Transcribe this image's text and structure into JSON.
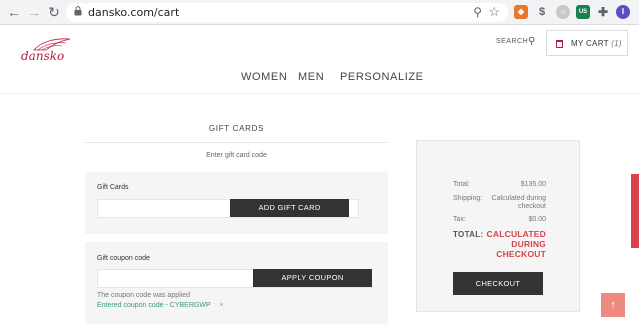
{
  "browser": {
    "url": "dansko.com/cart",
    "back_icon": "back-arrow-icon",
    "forward_icon": "forward-arrow-icon",
    "reload_icon": "reload-icon",
    "profile_initial": "I",
    "extensions": [
      "ext-badge",
      "ext-honey",
      "ext-dollar",
      "ext-circle",
      "ext-us",
      "puzzle-icon"
    ]
  },
  "header": {
    "logo_text": "dansko",
    "search_label": "SEARCH",
    "cart_label": "MY CART",
    "cart_count": "(1)"
  },
  "nav": [
    "WOMEN",
    "MEN",
    "PERSONALIZE"
  ],
  "gift_cards": {
    "title": "GIFT CARDS",
    "subtitle": "Enter gift card code",
    "label": "Gift Cards",
    "input_placeholder": "",
    "button": "ADD GIFT CARD"
  },
  "coupon": {
    "label": "Gift coupon code",
    "input_placeholder": "",
    "button": "APPLY COUPON",
    "applied_text": "The coupon code was applied",
    "entered_text": "Entered coupon code - CYBERGWP",
    "remove_symbol": "×"
  },
  "summary": {
    "total_label": "Total:",
    "total_value": "$135.00",
    "shipping_label": "Shipping:",
    "shipping_value_1": "Calculated during",
    "shipping_value_2": "checkout",
    "tax_label": "Tax:",
    "tax_value": "$0.00",
    "grand_label": "TOTAL:",
    "grand_value_1": "CALCULATED",
    "grand_value_2": "DURING",
    "grand_value_3": "CHECKOUT",
    "checkout_button": "CHECKOUT"
  },
  "widgets": {
    "scroll_top_symbol": "↑"
  },
  "colors": {
    "brand": "#b81d3a",
    "accent_red": "#d8434b",
    "coupon_green": "#3a9a72",
    "button_dark": "#333333"
  }
}
